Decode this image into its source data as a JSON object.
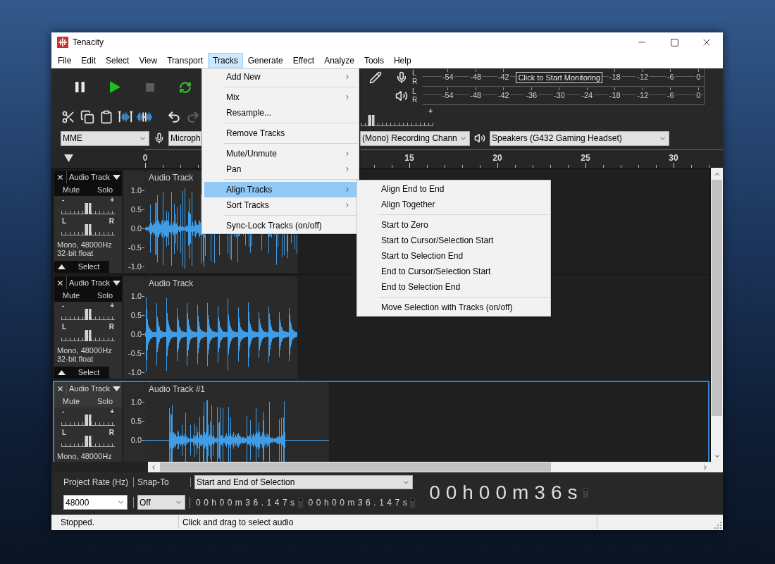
{
  "window": {
    "title": "Tenacity"
  },
  "menu_bar": [
    {
      "label": "File",
      "selected": false
    },
    {
      "label": "Edit",
      "selected": false
    },
    {
      "label": "Select",
      "selected": false
    },
    {
      "label": "View",
      "selected": false
    },
    {
      "label": "Transport",
      "selected": false
    },
    {
      "label": "Tracks",
      "selected": true
    },
    {
      "label": "Generate",
      "selected": false
    },
    {
      "label": "Effect",
      "selected": false
    },
    {
      "label": "Analyze",
      "selected": false
    },
    {
      "label": "Tools",
      "selected": false
    },
    {
      "label": "Help",
      "selected": false
    }
  ],
  "transport_buttons": [
    {
      "kind": "pause",
      "disabled": false
    },
    {
      "kind": "play",
      "disabled": false
    },
    {
      "kind": "stop",
      "disabled": true
    },
    {
      "kind": "loop",
      "disabled": false
    }
  ],
  "meters": [
    {
      "kind": "record",
      "channels": [
        "L",
        "R"
      ],
      "scale": [
        "-54",
        "-48",
        "-42"
      ],
      "monitor_button": "Click to Start Monitoring",
      "scale_after_button": [
        "-18",
        "-12",
        "-6",
        "0"
      ]
    },
    {
      "kind": "playback",
      "channels": [
        "L",
        "R"
      ],
      "scale": [
        "-54",
        "-48",
        "-42",
        "-36",
        "-30",
        "-24",
        "-18",
        "-12",
        "-6",
        "0"
      ]
    }
  ],
  "edit_buttons": [
    {
      "kind": "cut",
      "disabled": false
    },
    {
      "kind": "copy",
      "disabled": false
    },
    {
      "kind": "paste",
      "disabled": false
    },
    {
      "kind": "trim",
      "disabled": false
    },
    {
      "kind": "silence",
      "disabled": false
    },
    {
      "kind": "undo",
      "disabled": false
    },
    {
      "kind": "redo",
      "disabled": true
    }
  ],
  "volume_slider": {
    "max_label": "+",
    "level": 0.15
  },
  "devices": {
    "host": "MME",
    "recording_device": "Microph",
    "recording_channels": "(Mono) Recording Chann",
    "playback_device": "Speakers (G432 Gaming Headset)"
  },
  "timeline": {
    "labels": [
      "0",
      "15",
      "20",
      "25",
      "30"
    ]
  },
  "tracks": [
    {
      "kind": "speech",
      "name": "Audio Track",
      "mute": "Mute",
      "solo": "Solo",
      "gain": {
        "min_label": "-",
        "max_label": "+",
        "level": 0.5
      },
      "pan": {
        "min_label": "L",
        "max_label": "R",
        "level": 0.5
      },
      "info": [
        "Mono, 48000Hz",
        "32-bit float"
      ],
      "select": "Select",
      "scale": [
        "1.0",
        "0.5",
        "0.0",
        "-0.5",
        "-1.0"
      ],
      "clip_title": "Audio Track",
      "focused": false
    },
    {
      "kind": "pulses",
      "name": "Audio Track",
      "mute": "Mute",
      "solo": "Solo",
      "gain": {
        "min_label": "-",
        "max_label": "+",
        "level": 0.5
      },
      "pan": {
        "min_label": "L",
        "max_label": "R",
        "level": 0.5
      },
      "info": [
        "Mono, 48000Hz",
        "32-bit float"
      ],
      "select": "Select",
      "scale": [
        "1.0",
        "0.5",
        "0.0",
        "-0.5",
        "-1.0"
      ],
      "clip_title": "Audio Track",
      "focused": false
    },
    {
      "kind": "speech",
      "name": "Audio Track",
      "mute": "Mute",
      "solo": "Solo",
      "gain": {
        "min_label": "-",
        "max_label": "+",
        "level": 0.5
      },
      "pan": {
        "min_label": "L",
        "max_label": "R",
        "level": 0.5
      },
      "info": [
        "Mono, 48000Hz"
      ],
      "scale": [
        "1.0",
        "0.5",
        "0.0"
      ],
      "clip_title": "Audio Track #1",
      "focused": true
    }
  ],
  "selection_bar": {
    "rate_label": "Project Rate (Hz)",
    "snap_label": "Snap-To",
    "format": "Start and End of Selection",
    "rate": "48000",
    "snap": "Off",
    "start_time": "00h00m36.147s",
    "end_time": "00h00m36.147s",
    "position": "00h00m36s"
  },
  "status_bar": [
    "Stopped.",
    "Click and drag to select audio"
  ],
  "tracks_menu": [
    {
      "kind": "item",
      "label": "Add New",
      "submenu": true,
      "selected": false
    },
    {
      "kind": "separator"
    },
    {
      "kind": "item",
      "label": "Mix",
      "submenu": true,
      "selected": false
    },
    {
      "kind": "item",
      "label": "Resample...",
      "submenu": false,
      "selected": false
    },
    {
      "kind": "separator"
    },
    {
      "kind": "item",
      "label": "Remove Tracks",
      "submenu": false,
      "selected": false
    },
    {
      "kind": "separator"
    },
    {
      "kind": "item",
      "label": "Mute/Unmute",
      "submenu": true,
      "selected": false
    },
    {
      "kind": "item",
      "label": "Pan",
      "submenu": true,
      "selected": false
    },
    {
      "kind": "separator"
    },
    {
      "kind": "item",
      "label": "Align Tracks",
      "submenu": true,
      "selected": true
    },
    {
      "kind": "item",
      "label": "Sort Tracks",
      "submenu": true,
      "selected": false
    },
    {
      "kind": "separator"
    },
    {
      "kind": "item",
      "label": "Sync-Lock Tracks (on/off)",
      "submenu": false,
      "selected": false
    }
  ],
  "align_submenu": [
    {
      "kind": "item",
      "label": "Align End to End",
      "submenu": false,
      "selected": false
    },
    {
      "kind": "item",
      "label": "Align Together",
      "submenu": false,
      "selected": false
    },
    {
      "kind": "separator"
    },
    {
      "kind": "item",
      "label": "Start to Zero",
      "submenu": false,
      "selected": false
    },
    {
      "kind": "item",
      "label": "Start to Cursor/Selection Start",
      "submenu": false,
      "selected": false
    },
    {
      "kind": "item",
      "label": "Start to Selection End",
      "submenu": false,
      "selected": false
    },
    {
      "kind": "item",
      "label": "End to Cursor/Selection Start",
      "submenu": false,
      "selected": false
    },
    {
      "kind": "item",
      "label": "End to Selection End",
      "submenu": false,
      "selected": false
    },
    {
      "kind": "separator"
    },
    {
      "kind": "item",
      "label": "Move Selection with Tracks (on/off)",
      "submenu": false,
      "selected": false
    }
  ]
}
